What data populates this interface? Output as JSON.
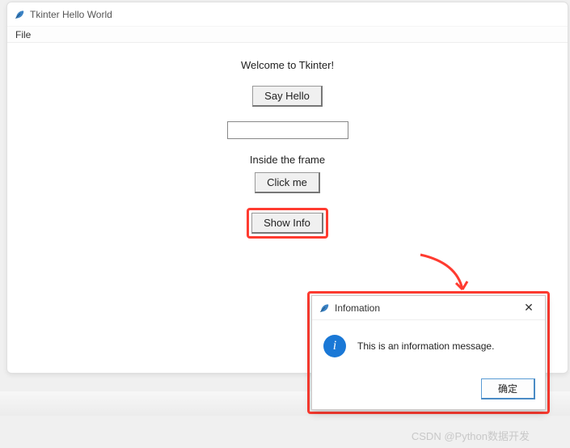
{
  "window": {
    "title": "Tkinter Hello World"
  },
  "menubar": {
    "file": "File"
  },
  "content": {
    "welcome": "Welcome to Tkinter!",
    "say_hello": "Say Hello",
    "entry_value": "",
    "frame_label": "Inside the frame",
    "click_me": "Click me",
    "show_info": "Show Info"
  },
  "dialog": {
    "title": "Infomation",
    "message": "This is an information message.",
    "ok": "确定",
    "close": "✕"
  },
  "info_icon_glyph": "i",
  "watermark": "CSDN @Python数据开发"
}
